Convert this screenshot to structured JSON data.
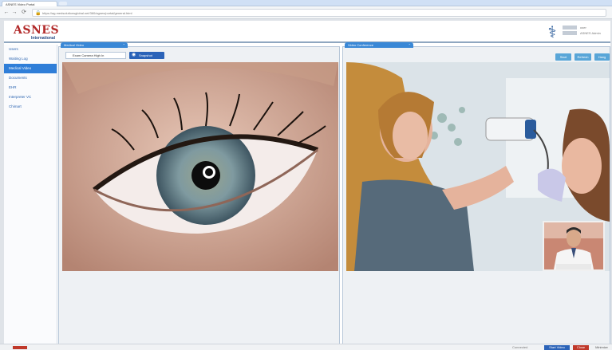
{
  "browser": {
    "tab_title": "ASNES Video Portal",
    "url": "https://ag.medsolutionsglobal.net/360/agnes/portal/general.html",
    "back_glyph": "←",
    "forward_glyph": "→",
    "reload_glyph": "⟳",
    "lock_glyph": "🔒"
  },
  "header": {
    "logo_text": "ASNES",
    "logo_sub": "International",
    "user_icon_glyph": "⚕",
    "user_line_1": "user",
    "user_line_2": "ASNES Admin"
  },
  "sidebar": {
    "items": [
      {
        "label": "Users"
      },
      {
        "label": "Waiting Log"
      },
      {
        "label": "Medical Video"
      },
      {
        "label": "Documents"
      },
      {
        "label": "EHR"
      },
      {
        "label": "Interpreter VC"
      },
      {
        "label": "Chimart"
      }
    ],
    "active_index": 2
  },
  "left_panel": {
    "tab_label": "Medical Video",
    "chevron_glyph": "⌃",
    "camera_value": "Exam Camera High In",
    "snapshot_label": "Snapshot",
    "camera_glyph": "◉"
  },
  "right_panel": {
    "tab_label": "Video Conference",
    "chevron_glyph": "⌃",
    "buttons": [
      "Start",
      "Refresh",
      "Hang"
    ]
  },
  "footer": {
    "link_text": "Connected",
    "buttons": [
      "Start Video",
      "Close",
      "Minimize"
    ]
  },
  "colors": {
    "accent": "#2f7ed8",
    "header_border": "#8fa7c0",
    "logo_red": "#b22a2a",
    "logo_blue": "#274a84"
  }
}
